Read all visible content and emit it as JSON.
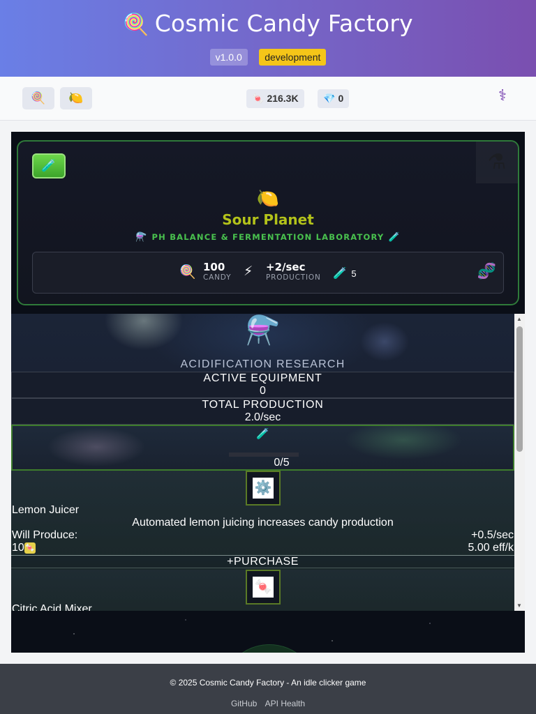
{
  "header": {
    "logo_icon": "🍭",
    "title": "Cosmic Candy Factory",
    "version": "v1.0.0",
    "environment": "development"
  },
  "toolbar": {
    "planets": [
      {
        "icon": "🍭",
        "name": "lollipop-planet"
      },
      {
        "icon": "🍋",
        "name": "sour-planet"
      }
    ],
    "candy_icon": "🍬",
    "candy_count": "216.3K",
    "gem_icon": "💎",
    "gem_count": "0",
    "menu_icon": "⚕"
  },
  "planet_card": {
    "lab_icon": "🧪",
    "corner_icon": "⚗",
    "planet_icon": "🍋",
    "name": "Sour Planet",
    "subtitle_left_icon": "⚗️",
    "subtitle": "PH BALANCE & FERMENTATION LABORATORY",
    "subtitle_right_icon": "🧪",
    "stats": {
      "candy_icon": "🍭",
      "candy_value": "100",
      "candy_label": "CANDY",
      "production_icon": "⚡",
      "production_value": "+2/sec",
      "production_label": "PRODUCTION",
      "tubes_icon": "🧪",
      "tubes_value": "5",
      "dna_icon": "🧬"
    }
  },
  "research": {
    "flask_icon": "⚗️",
    "title": "ACIDIFICATION RESEARCH",
    "active_equipment_label": "ACTIVE EQUIPMENT",
    "active_equipment_value": "0",
    "total_production_label": "TOTAL PRODUCTION",
    "total_production_value": "2.0/sec",
    "progress_icon": "🧪",
    "progress_text": "0/5",
    "progress_fraction": 0,
    "equipment": [
      {
        "icon": "⚙️",
        "name": "Lemon Juicer",
        "description": "Automated lemon juicing increases candy production",
        "will_produce_label": "Will Produce:",
        "will_produce_value": "+0.5/sec",
        "cost": "10",
        "cost_icon": "🍬",
        "efficiency": "5.00 eff/k",
        "purchase_label": "+PURCHASE"
      },
      {
        "icon": "🍬",
        "name": "Citric Acid Mixer"
      }
    ]
  },
  "footer": {
    "copyright": "© 2025 Cosmic Candy Factory - An idle clicker game",
    "links": [
      "GitHub",
      "API Health"
    ]
  }
}
